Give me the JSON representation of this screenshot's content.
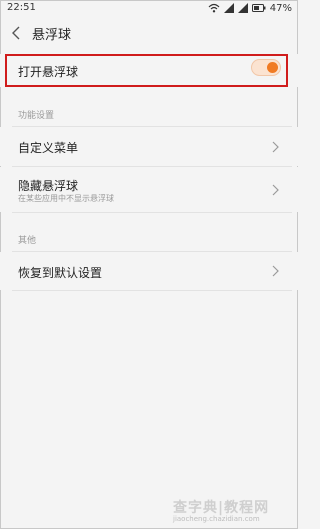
{
  "status_bar": {
    "time": "22:51",
    "battery": "47%",
    "icons": [
      "wifi-icon",
      "signal-icon",
      "signal-icon",
      "battery-icon"
    ]
  },
  "header": {
    "back_icon": "chevron-left-icon",
    "title": "悬浮球"
  },
  "main_toggle": {
    "label": "打开悬浮球",
    "state": "on",
    "accent_color": "#f07b24",
    "highlight_color": "#d01c1c"
  },
  "sections": [
    {
      "header": "功能设置",
      "items": [
        {
          "label": "自定义菜单",
          "icon": "chevron-right-icon"
        },
        {
          "label": "隐藏悬浮球",
          "sublabel": "在某些应用中不显示悬浮球",
          "icon": "chevron-right-icon"
        }
      ]
    },
    {
      "header": "其他",
      "items": [
        {
          "label": "恢复到默认设置",
          "icon": "chevron-right-icon"
        }
      ]
    }
  ],
  "watermark": {
    "main": "查字典|教程网",
    "sub": "jiaocheng.chazidian.com"
  }
}
